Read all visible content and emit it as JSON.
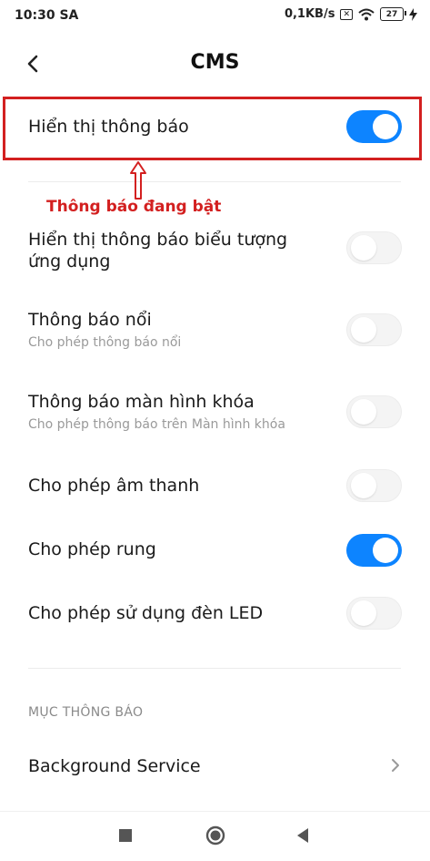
{
  "status_bar": {
    "time": "10:30 SA",
    "net_speed": "0,1KB/s",
    "battery": "27"
  },
  "header": {
    "title": "CMS"
  },
  "settings": [
    {
      "title": "Hiển thị thông báo",
      "subtitle": "",
      "enabled": true
    },
    {
      "title": "Hiển thị thông báo biểu tượng ứng dụng",
      "subtitle": "",
      "enabled": false
    },
    {
      "title": "Thông báo nổi",
      "subtitle": "Cho phép thông báo nổi",
      "enabled": false
    },
    {
      "title": "Thông báo màn hình khóa",
      "subtitle": "Cho phép thông báo trên Màn hình khóa",
      "enabled": false
    },
    {
      "title": "Cho phép âm thanh",
      "subtitle": "",
      "enabled": false
    },
    {
      "title": "Cho phép rung",
      "subtitle": "",
      "enabled": true
    },
    {
      "title": "Cho phép sử dụng đèn LED",
      "subtitle": "",
      "enabled": false
    }
  ],
  "annotation": {
    "text": "Thông báo đang bật",
    "color": "#d32020"
  },
  "section": {
    "header": "MỤC THÔNG BÁO",
    "items": [
      {
        "title": "Background Service"
      }
    ]
  },
  "colors": {
    "toggle_on": "#0d84ff",
    "toggle_off": "#f4f4f4"
  },
  "icons": {
    "back": "chevron-left-icon",
    "item_arrow": "chevron-right-icon",
    "nav_recents": "square-icon",
    "nav_home": "circle-icon",
    "nav_back": "triangle-icon"
  }
}
